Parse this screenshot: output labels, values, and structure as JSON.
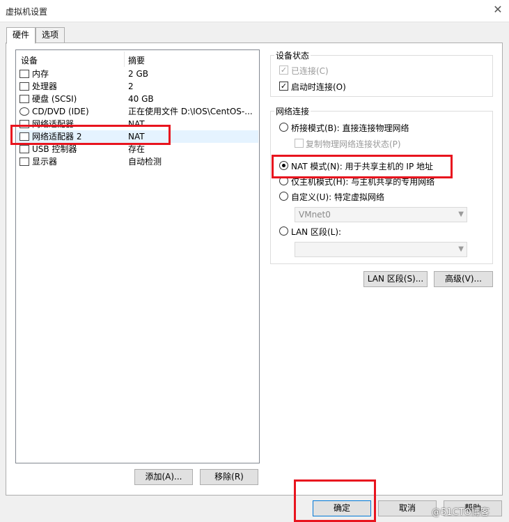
{
  "window": {
    "title": "虚拟机设置"
  },
  "tabs": [
    "硬件",
    "选项"
  ],
  "device_table": {
    "headers": {
      "device": "设备",
      "summary": "摘要"
    },
    "rows": [
      {
        "icon": "memory-icon",
        "name": "内存",
        "summary": "2 GB"
      },
      {
        "icon": "cpu-icon",
        "name": "处理器",
        "summary": "2"
      },
      {
        "icon": "disk-icon",
        "name": "硬盘 (SCSI)",
        "summary": "40 GB"
      },
      {
        "icon": "cd-icon",
        "name": "CD/DVD (IDE)",
        "summary": "正在使用文件 D:\\IOS\\CentOS-..."
      },
      {
        "icon": "network-icon",
        "name": "网络适配器",
        "summary": "NAT"
      },
      {
        "icon": "network-icon",
        "name": "网络适配器 2",
        "summary": "NAT",
        "selected": true
      },
      {
        "icon": "usb-icon",
        "name": "USB 控制器",
        "summary": "存在"
      },
      {
        "icon": "display-icon",
        "name": "显示器",
        "summary": "自动检测"
      }
    ],
    "add_button": "添加(A)...",
    "remove_button": "移除(R)"
  },
  "device_status": {
    "title": "设备状态",
    "connected": {
      "label": "已连接(C)",
      "checked": true,
      "disabled": true
    },
    "connect_on_start": {
      "label": "启动时连接(O)",
      "checked": true
    }
  },
  "network": {
    "title": "网络连接",
    "bridged": "桥接模式(B): 直接连接物理网络",
    "replicate": "复制物理网络连接状态(P)",
    "nat": "NAT 模式(N): 用于共享主机的 IP 地址",
    "host_only": "仅主机模式(H): 与主机共享的专用网络",
    "custom": "自定义(U): 特定虚拟网络",
    "custom_value": "VMnet0",
    "lan": "LAN 区段(L):",
    "lan_value": "",
    "selected": "nat"
  },
  "lan_segments_button": "LAN 区段(S)...",
  "advanced_button": "高级(V)...",
  "footer": {
    "ok": "确定",
    "cancel": "取消",
    "help": "帮助"
  },
  "watermark": "@51CTO博客",
  "colors": {
    "highlight": "#e8141e",
    "selection": "#e5f3ff"
  }
}
